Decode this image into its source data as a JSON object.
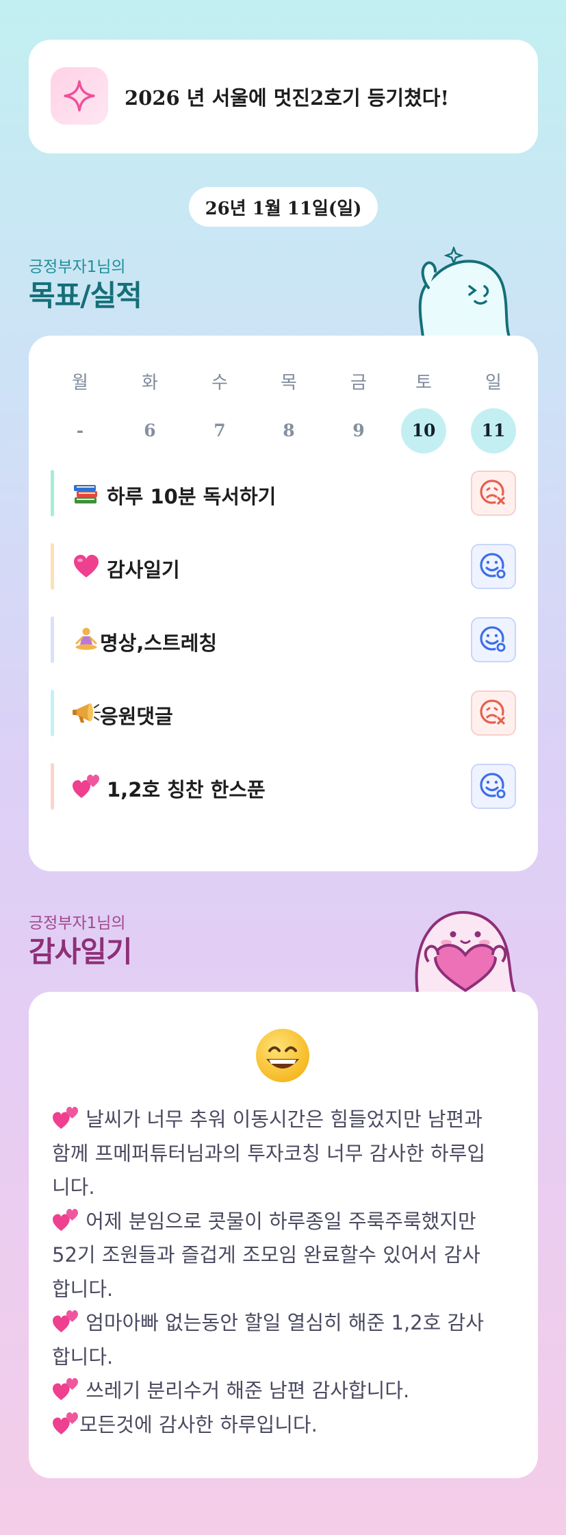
{
  "goal": {
    "icon": "sparkle-icon",
    "text": "2026 년 서울에 멋진2호기 등기쳤다!"
  },
  "date": {
    "label": "26년 1월 11일(일)"
  },
  "habits_section": {
    "subtitle": "긍정부자1님의",
    "title": "목표/실적"
  },
  "week": {
    "days": [
      "월",
      "화",
      "수",
      "목",
      "금",
      "토",
      "일"
    ],
    "dates": [
      "-",
      "6",
      "7",
      "8",
      "9",
      "10",
      "11"
    ],
    "active": [
      false,
      false,
      false,
      false,
      false,
      true,
      true
    ]
  },
  "habits": [
    {
      "label": "하루 10분 독서하기",
      "icon": "books-icon",
      "bar_color": "#a8ecd8",
      "status": "fail"
    },
    {
      "label": "감사일기",
      "icon": "pink-heart-icon",
      "bar_color": "#fde0b6",
      "status": "done"
    },
    {
      "label": "명상,스트레칭",
      "icon": "meditation-icon",
      "bar_color": "#d8e0fb",
      "status": "done"
    },
    {
      "label": "응원댓글",
      "icon": "megaphone-icon",
      "bar_color": "#c4f0f6",
      "status": "fail"
    },
    {
      "label": "1,2호 칭찬 한스푼",
      "icon": "two-hearts-icon",
      "bar_color": "#fcd4cc",
      "status": "done"
    }
  ],
  "diary_section": {
    "subtitle": "긍정부자1님의",
    "title": "감사일기"
  },
  "diary": {
    "mood_icon": "grinning-face-icon",
    "lines": [
      " 날씨가 너무 추워 이동시간은 힘들었지만 남편과",
      "함께 프메퍼튜터님과의 투자코칭 너무 감사한 하루입",
      "니다.",
      " 어제 분임으로 콧물이 하루종일 주룩주룩했지만",
      "52기 조원들과 즐겁게 조모임 완료할수 있어서 감사",
      "합니다.",
      " 엄마아빠 없는동안 할일 열심히 해준 1,2호 감사",
      "합니다.",
      " 쓰레기 분리수거 해준 남편 감사합니다.",
      "모든것에 감사한 하루입니다."
    ],
    "heart_lines": [
      0,
      3,
      6,
      8,
      9
    ]
  },
  "colors": {
    "fail": "#e5604d",
    "done": "#3d6ee8",
    "active_day": "#c3eff3"
  }
}
